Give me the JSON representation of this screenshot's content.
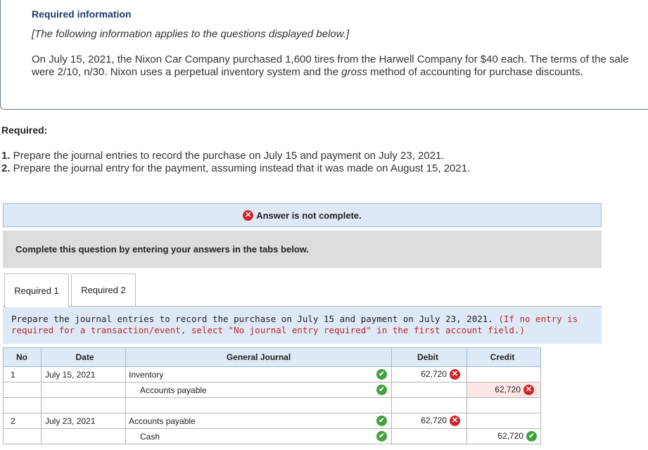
{
  "info": {
    "title": "Required information",
    "note": "[The following information applies to the questions displayed below.]",
    "body_pre": "On July 15, 2021, the Nixon Car Company purchased 1,600 tires from the Harwell Company for $40 each. The terms of the sale were 2/10, n/30. Nixon uses a perpetual inventory system and the ",
    "body_emph": "gross",
    "body_post": " method of accounting for purchase discounts."
  },
  "required": {
    "heading": "Required:",
    "items": [
      {
        "num": "1.",
        "text": " Prepare the journal entries to record the purchase on July 15 and payment on July 23, 2021."
      },
      {
        "num": "2.",
        "text": " Prepare the journal entry for the payment, assuming instead that it was made on August 15, 2021."
      }
    ]
  },
  "status": {
    "icon": "error-x-icon",
    "text": "Answer is not complete."
  },
  "instruction": "Complete this question by entering your answers in the tabs below.",
  "tabs": [
    {
      "label": "Required 1",
      "active": true
    },
    {
      "label": "Required 2",
      "active": false
    }
  ],
  "prompt": {
    "main": "Prepare the journal entries to record the purchase on July 15 and payment on July 23, 2021. ",
    "hint": "(If no entry is required for a transaction/event, select \"No journal entry required\" in the first account field.)"
  },
  "journal": {
    "headers": {
      "no": "No",
      "date": "Date",
      "account": "General Journal",
      "debit": "Debit",
      "credit": "Credit"
    },
    "rows": [
      {
        "no": "1",
        "date": "July 15, 2021",
        "account": "Inventory",
        "debit": "62,720",
        "credit": ""
      },
      {
        "no": "",
        "date": "",
        "account": "Accounts payable",
        "debit": "",
        "credit": "62,720"
      },
      {
        "no": "",
        "date": "",
        "account": "",
        "debit": "",
        "credit": ""
      },
      {
        "no": "2",
        "date": "July 23, 2021",
        "account": "Accounts payable",
        "debit": "62,720",
        "credit": ""
      },
      {
        "no": "",
        "date": "",
        "account": "Cash",
        "debit": "",
        "credit": "62,720"
      }
    ]
  },
  "colors": {
    "error": "#d0242b",
    "correct": "#3fa23f",
    "accent": "#1c3a6e",
    "hint": "#c0262d"
  }
}
